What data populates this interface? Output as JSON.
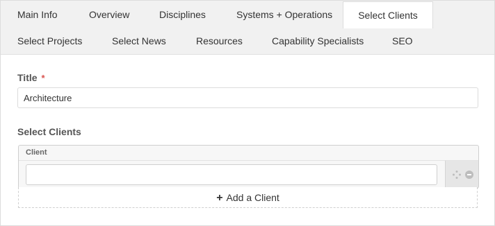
{
  "tabs": {
    "row1": [
      "Main Info",
      "Overview",
      "Disciplines",
      "Systems + Operations",
      "Select Clients"
    ],
    "row2": [
      "Select Projects",
      "Select News",
      "Resources",
      "Capability Specialists",
      "SEO"
    ],
    "active": "Select Clients"
  },
  "title_field": {
    "label": "Title",
    "required_marker": "*",
    "value": "Architecture"
  },
  "clients_section": {
    "label": "Select Clients",
    "column_header": "Client",
    "rows": [
      {
        "client": ""
      }
    ],
    "add_icon": "+",
    "add_label": "Add a Client"
  },
  "colors": {
    "tabbar_bg": "#f1f1f1",
    "required": "#d9534f",
    "border": "#dcdcdc"
  }
}
